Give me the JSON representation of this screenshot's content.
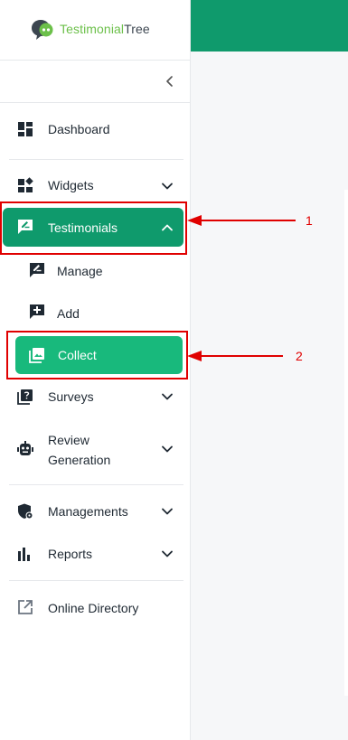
{
  "brand": {
    "name_part1": "Testimonial",
    "name_part2": "Tree"
  },
  "colors": {
    "primary": "#0f9a6c",
    "active_sub": "#18b97c",
    "annotation": "#e00000"
  },
  "sidebar": {
    "collapse_icon": "chevron-left-icon",
    "items": [
      {
        "label": "Dashboard",
        "icon": "dashboard-icon"
      },
      {
        "label": "Widgets",
        "icon": "widgets-icon"
      },
      {
        "label": "Testimonials",
        "icon": "testimonials-icon"
      },
      {
        "label": "Manage",
        "icon": "manage-icon"
      },
      {
        "label": "Add",
        "icon": "add-icon"
      },
      {
        "label": "Collect",
        "icon": "collect-icon"
      },
      {
        "label": "Surveys",
        "icon": "surveys-icon"
      },
      {
        "label_line1": "Review",
        "label_line2": "Generation",
        "icon": "robot-icon"
      },
      {
        "label": "Managements",
        "icon": "shield-icon"
      },
      {
        "label": "Reports",
        "icon": "bar-chart-icon"
      },
      {
        "label": "Online Directory",
        "icon": "external-link-icon"
      }
    ]
  },
  "annotations": [
    {
      "label": "1"
    },
    {
      "label": "2"
    }
  ]
}
